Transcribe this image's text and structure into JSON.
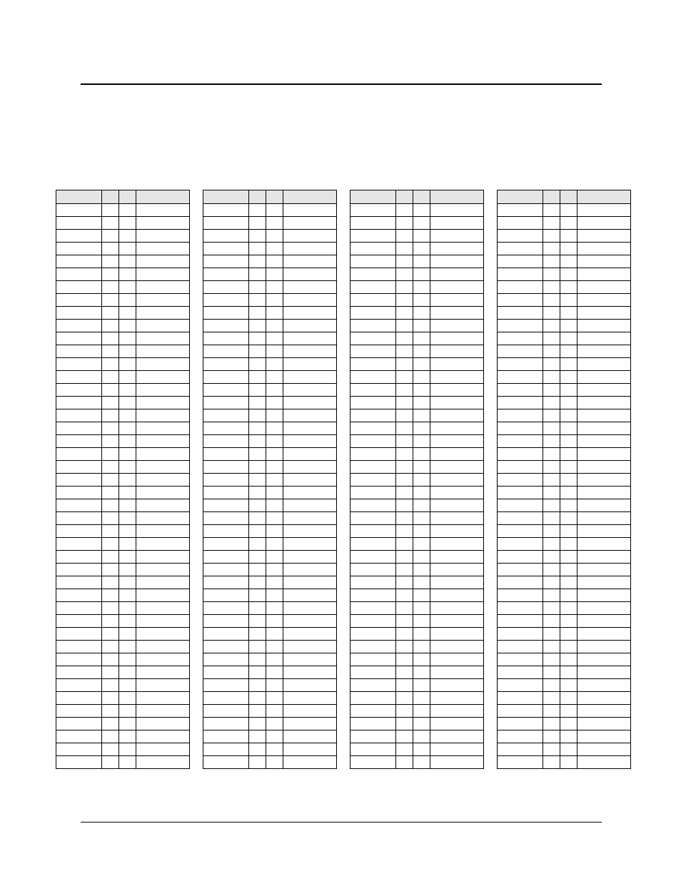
{
  "layout": {
    "tables": 4,
    "columns_per_table": 4,
    "header_rows": 1,
    "body_rows": 44,
    "column_headers": [
      "",
      "",
      "",
      ""
    ]
  }
}
